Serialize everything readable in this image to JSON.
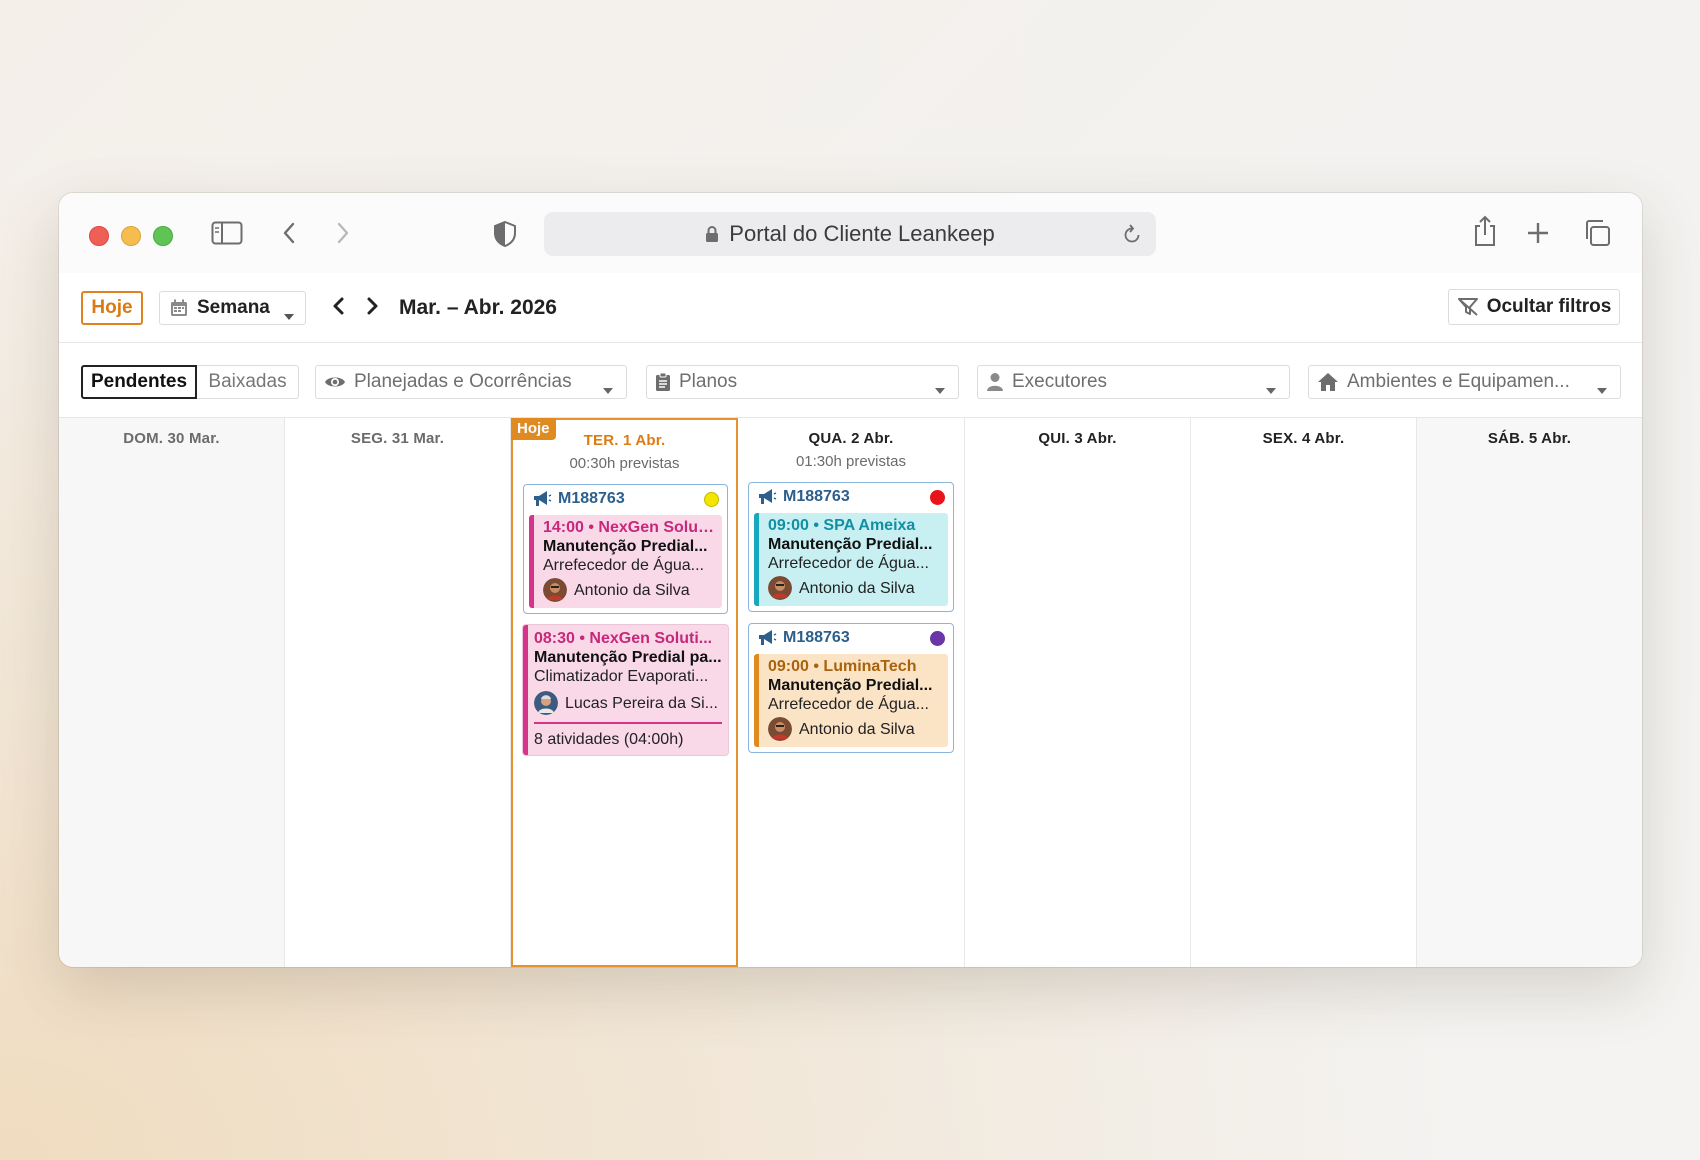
{
  "browser": {
    "url_title": "Portal do Cliente Leankeep"
  },
  "toolbar": {
    "today_label": "Hoje",
    "view_select": "Semana",
    "date_range": "Mar. – Abr. 2026",
    "hide_filters_label": "Ocultar filtros"
  },
  "filters": {
    "status_tabs": [
      "Pendentes",
      "Baixadas"
    ],
    "dropdowns": {
      "planned": "Planejadas e Ocorrências",
      "plans": "Planos",
      "executors": "Executores",
      "environments": "Ambientes e Equipamen..."
    }
  },
  "calendar": {
    "today_tag": "Hoje",
    "days": [
      {
        "label": "DOM. 30 Mar.",
        "subtitle": ""
      },
      {
        "label": "SEG. 31 Mar.",
        "subtitle": ""
      },
      {
        "label": "TER. 1 Abr.",
        "subtitle": "00:30h previstas"
      },
      {
        "label": "QUA. 2 Abr.",
        "subtitle": "01:30h previstas"
      },
      {
        "label": "QUI. 3 Abr.",
        "subtitle": ""
      },
      {
        "label": "SEX. 4 Abr.",
        "subtitle": ""
      },
      {
        "label": "SÁB. 5 Abr.",
        "subtitle": ""
      }
    ],
    "tue_cards": [
      {
        "code": "M188763",
        "status_color": "#f2e600",
        "activity": {
          "time_client": "14:00 • NexGen Solut...",
          "title": "Manutenção Predial...",
          "asset": "Arrefecedor de Água...",
          "person": "Antonio da Silva"
        }
      }
    ],
    "tue_standalone": {
      "time_client": "08:30 • NexGen Soluti...",
      "title": "Manutenção Predial pa...",
      "asset": "Climatizador Evaporati...",
      "person": "Lucas Pereira da Si...",
      "summary": "8 atividades (04:00h)"
    },
    "wed_cards": [
      {
        "code": "M188763",
        "status_color": "#e8141c",
        "activity": {
          "time_client": "09:00 • SPA Ameixa",
          "title": "Manutenção Predial...",
          "asset": "Arrefecedor de Água...",
          "person": "Antonio da Silva"
        }
      },
      {
        "code": "M188763",
        "status_color": "#6a35a8",
        "activity": {
          "time_client": "09:00 • LuminaTech",
          "title": "Manutenção Predial...",
          "asset": "Arrefecedor de Água...",
          "person": "Antonio da Silva"
        }
      }
    ]
  },
  "colors": {
    "accent_today": "#e08a22",
    "card_border": "#8ab6dc",
    "pink": "#d6338b",
    "cyan": "#17a7bf",
    "orange": "#e08a22"
  },
  "icons": [
    "sidebar-icon",
    "back-icon",
    "forward-icon",
    "shield-icon",
    "lock-icon",
    "reload-icon",
    "share-icon",
    "new-tab-icon",
    "tabs-icon",
    "calendar-icon",
    "caret-down-icon",
    "chevron-left-icon",
    "chevron-right-icon",
    "filter-off-icon",
    "eye-icon",
    "clipboard-icon",
    "user-icon",
    "home-icon",
    "megaphone-icon"
  ]
}
